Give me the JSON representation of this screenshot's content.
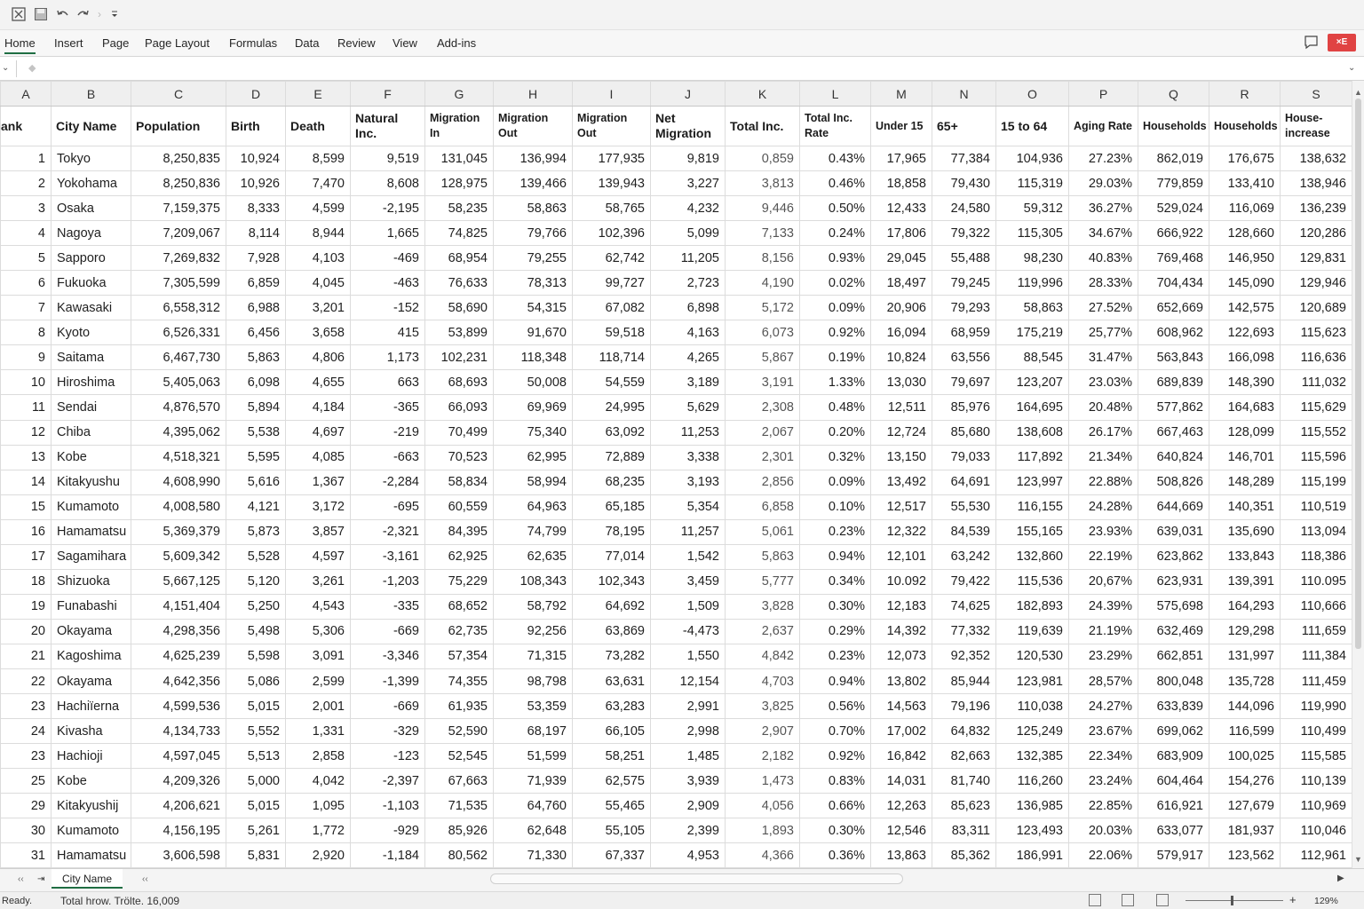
{
  "ribbon": {
    "tabs": [
      "Home",
      "Insert",
      "Page",
      "Page Layout",
      "Formulas",
      "Data",
      "Review",
      "View",
      "Add-ins"
    ],
    "active_tab": "Home",
    "close_label": "×E"
  },
  "columns": [
    "A",
    "B",
    "C",
    "D",
    "E",
    "F",
    "G",
    "H",
    "I",
    "J",
    "K",
    "L",
    "M",
    "N",
    "O",
    "P",
    "Q",
    "R",
    "S"
  ],
  "headers": [
    "ank",
    "City Name",
    "Population",
    "Birth",
    "Death",
    "Natural Inc.",
    "Migration In",
    "Migration Out",
    "Migration Out",
    "Net Migration",
    "Total Inc.",
    "Total Inc. Rate",
    "Under 15",
    "65+",
    "15 to 64",
    "Aging Rate",
    "Households",
    "Households",
    "House-increase"
  ],
  "rows": [
    [
      "1",
      "Tokyo",
      "8,250,835",
      "10,924",
      "8,599",
      "9,519",
      "131,045",
      "136,994",
      "177,935",
      "9,819",
      "0,859",
      "0.43%",
      "17,965",
      "77,384",
      "104,936",
      "27.23%",
      "862,019",
      "176,675",
      "138,632"
    ],
    [
      "2",
      "Yokohama",
      "8,250,836",
      "10,926",
      "7,470",
      "8,608",
      "128,975",
      "139,466",
      "139,943",
      "3,227",
      "3,813",
      "0.46%",
      "18,858",
      "79,430",
      "115,319",
      "29.03%",
      "779,859",
      "133,410",
      "138,946"
    ],
    [
      "3",
      "Osaka",
      "7,159,375",
      "8,333",
      "4,599",
      "-2,195",
      "58,235",
      "58,863",
      "58,765",
      "4,232",
      "9,446",
      "0.50%",
      "12,433",
      "24,580",
      "59,312",
      "36.27%",
      "529,024",
      "116,069",
      "136,239"
    ],
    [
      "4",
      "Nagoya",
      "7,209,067",
      "8,114",
      "8,944",
      "1,665",
      "74,825",
      "79,766",
      "102,396",
      "5,099",
      "7,133",
      "0.24%",
      "17,806",
      "79,322",
      "115,305",
      "34.67%",
      "666,922",
      "128,660",
      "120,286"
    ],
    [
      "5",
      "Sapporo",
      "7,269,832",
      "7,928",
      "4,103",
      "-469",
      "68,954",
      "79,255",
      "62,742",
      "11,205",
      "8,156",
      "0.93%",
      "29,045",
      "55,488",
      "98,230",
      "40.83%",
      "769,468",
      "146,950",
      "129,831"
    ],
    [
      "6",
      "Fukuoka",
      "7,305,599",
      "6,859",
      "4,045",
      "-463",
      "76,633",
      "78,313",
      "99,727",
      "2,723",
      "4,190",
      "0.02%",
      "18,497",
      "79,245",
      "119,996",
      "28.33%",
      "704,434",
      "145,090",
      "129,946"
    ],
    [
      "7",
      "Kawasaki",
      "6,558,312",
      "6,988",
      "3,201",
      "-152",
      "58,690",
      "54,315",
      "67,082",
      "6,898",
      "5,172",
      "0.09%",
      "20,906",
      "79,293",
      "58,863",
      "27.52%",
      "652,669",
      "142,575",
      "120,689"
    ],
    [
      "8",
      "Kyoto",
      "6,526,331",
      "6,456",
      "3,658",
      "415",
      "53,899",
      "91,670",
      "59,518",
      "4,163",
      "6,073",
      "0.92%",
      "16,094",
      "68,959",
      "175,219",
      "25,77%",
      "608,962",
      "122,693",
      "115,623"
    ],
    [
      "9",
      "Saitama",
      "6,467,730",
      "5,863",
      "4,806",
      "1,173",
      "102,231",
      "118,348",
      "118,714",
      "4,265",
      "5,867",
      "0.19%",
      "10,824",
      "63,556",
      "88,545",
      "31.47%",
      "563,843",
      "166,098",
      "116,636"
    ],
    [
      "10",
      "Hiroshima",
      "5,405,063",
      "6,098",
      "4,655",
      "663",
      "68,693",
      "50,008",
      "54,559",
      "3,189",
      "3,191",
      "1.33%",
      "13,030",
      "79,697",
      "123,207",
      "23.03%",
      "689,839",
      "148,390",
      "111,032"
    ],
    [
      "11",
      "Sendai",
      "4,876,570",
      "5,894",
      "4,184",
      "-365",
      "66,093",
      "69,969",
      "24,995",
      "5,629",
      "2,308",
      "0.48%",
      "12,511",
      "85,976",
      "164,695",
      "20.48%",
      "577,862",
      "164,683",
      "115,629"
    ],
    [
      "12",
      "Chiba",
      "4,395,062",
      "5,538",
      "4,697",
      "-219",
      "70,499",
      "75,340",
      "63,092",
      "11,253",
      "2,067",
      "0.20%",
      "12,724",
      "85,680",
      "138,608",
      "26.17%",
      "667,463",
      "128,099",
      "115,552"
    ],
    [
      "13",
      "Kobe",
      "4,518,321",
      "5,595",
      "4,085",
      "-663",
      "70,523",
      "62,995",
      "72,889",
      "3,338",
      "2,301",
      "0.32%",
      "13,150",
      "79,033",
      "117,892",
      "21.34%",
      "640,824",
      "146,701",
      "115,596"
    ],
    [
      "14",
      "Kitakyushu",
      "4,608,990",
      "5,616",
      "1,367",
      "-2,284",
      "58,834",
      "58,994",
      "68,235",
      "3,193",
      "2,856",
      "0.09%",
      "13,492",
      "64,691",
      "123,997",
      "22.88%",
      "508,826",
      "148,289",
      "115,199"
    ],
    [
      "15",
      "Kumamoto",
      "4,008,580",
      "4,121",
      "3,172",
      "-695",
      "60,559",
      "64,963",
      "65,185",
      "5,354",
      "6,858",
      "0.10%",
      "12,517",
      "55,530",
      "116,155",
      "24.28%",
      "644,669",
      "140,351",
      "110,519"
    ],
    [
      "16",
      "Hamamatsu",
      "5,369,379",
      "5,873",
      "3,857",
      "-2,321",
      "84,395",
      "74,799",
      "78,195",
      "11,257",
      "5,061",
      "0.23%",
      "12,322",
      "84,539",
      "155,165",
      "23.93%",
      "639,031",
      "135,690",
      "113,094"
    ],
    [
      "17",
      "Sagamihara",
      "5,609,342",
      "5,528",
      "4,597",
      "-3,161",
      "62,925",
      "62,635",
      "77,014",
      "1,542",
      "5,863",
      "0.94%",
      "12,101",
      "63,242",
      "132,860",
      "22.19%",
      "623,862",
      "133,843",
      "118,386"
    ],
    [
      "18",
      "Shizuoka",
      "5,667,125",
      "5,120",
      "3,261",
      "-1,203",
      "75,229",
      "108,343",
      "102,343",
      "3,459",
      "5,777",
      "0.34%",
      "10.092",
      "79,422",
      "115,536",
      "20,67%",
      "623,931",
      "139,391",
      "110.095"
    ],
    [
      "19",
      "Funabashi",
      "4,151,404",
      "5,250",
      "4,543",
      "-335",
      "68,652",
      "58,792",
      "64,692",
      "1,509",
      "3,828",
      "0.30%",
      "12,183",
      "74,625",
      "182,893",
      "24.39%",
      "575,698",
      "164,293",
      "110,666"
    ],
    [
      "20",
      "Okayama",
      "4,298,356",
      "5,498",
      "5,306",
      "-669",
      "62,735",
      "92,256",
      "63,869",
      "-4,473",
      "2,637",
      "0.29%",
      "14,392",
      "77,332",
      "119,639",
      "21.19%",
      "632,469",
      "129,298",
      "111,659"
    ],
    [
      "21",
      "Kagoshima",
      "4,625,239",
      "5,598",
      "3,091",
      "-3,346",
      "57,354",
      "71,315",
      "73,282",
      "1,550",
      "4,842",
      "0.23%",
      "12,073",
      "92,352",
      "120,530",
      "23.29%",
      "662,851",
      "131,997",
      "111,384"
    ],
    [
      "22",
      "Okayama",
      "4,642,356",
      "5,086",
      "2,599",
      "-1,399",
      "74,355",
      "98,798",
      "63,631",
      "12,154",
      "4,703",
      "0.94%",
      "13,802",
      "85,944",
      "123,981",
      "28,57%",
      "800,048",
      "135,728",
      "111,459"
    ],
    [
      "23",
      "Hachiїerna",
      "4,599,536",
      "5,015",
      "2,001",
      "-669",
      "61,935",
      "53,359",
      "63,283",
      "2,991",
      "3,825",
      "0.56%",
      "14,563",
      "79,196",
      "110,038",
      "24.27%",
      "633,839",
      "144,096",
      "119,990"
    ],
    [
      "24",
      "Kivasha",
      "4,134,733",
      "5,552",
      "1,331",
      "-329",
      "52,590",
      "68,197",
      "66,105",
      "2,998",
      "2,907",
      "0.70%",
      "17,002",
      "64,832",
      "125,249",
      "23.67%",
      "699,062",
      "116,599",
      "110,499"
    ],
    [
      "23",
      "Hachioji",
      "4,597,045",
      "5,513",
      "2,858",
      "-123",
      "52,545",
      "51,599",
      "58,251",
      "1,485",
      "2,182",
      "0.92%",
      "16,842",
      "82,663",
      "132,385",
      "22.34%",
      "683,909",
      "100,025",
      "115,585"
    ],
    [
      "25",
      "Kobe",
      "4,209,326",
      "5,000",
      "4,042",
      "-2,397",
      "67,663",
      "71,939",
      "62,575",
      "3,939",
      "1,473",
      "0.83%",
      "14,031",
      "81,740",
      "116,260",
      "23.24%",
      "604,464",
      "154,276",
      "110,139"
    ],
    [
      "29",
      "Kitakyushij",
      "4,206,621",
      "5,015",
      "1,095",
      "-1,103",
      "71,535",
      "64,760",
      "55,465",
      "2,909",
      "4,056",
      "0.66%",
      "12,263",
      "85,623",
      "136,985",
      "22.85%",
      "616,921",
      "127,679",
      "110,969"
    ],
    [
      "30",
      "Kumamoto",
      "4,156,195",
      "5,261",
      "1,772",
      "-929",
      "85,926",
      "62,648",
      "55,105",
      "2,399",
      "1,893",
      "0.30%",
      "12,546",
      "83,311",
      "123,493",
      "20.03%",
      "633,077",
      "181,937",
      "110,046"
    ],
    [
      "31",
      "Hamamatsu",
      "3,606,598",
      "5,831",
      "2,920",
      "-1,184",
      "80,562",
      "71,330",
      "67,337",
      "4,953",
      "4,366",
      "0.36%",
      "13,863",
      "85,362",
      "186,991",
      "22.06%",
      "579,917",
      "123,562",
      "112,961"
    ]
  ],
  "sheet_tab": "City Name",
  "status": {
    "ready": "Ready.",
    "summary": "Total hrow. Trölte. 16,009",
    "zoom": "129%",
    "plus": "+"
  },
  "icons": [
    "excel-icon",
    "save-icon",
    "undo-icon",
    "redo-icon",
    "customize-icon",
    "comment-icon",
    "close-icon",
    "scroll-up-icon",
    "scroll-down-icon",
    "normal-view-icon",
    "page-layout-view-icon",
    "page-break-view-icon"
  ]
}
